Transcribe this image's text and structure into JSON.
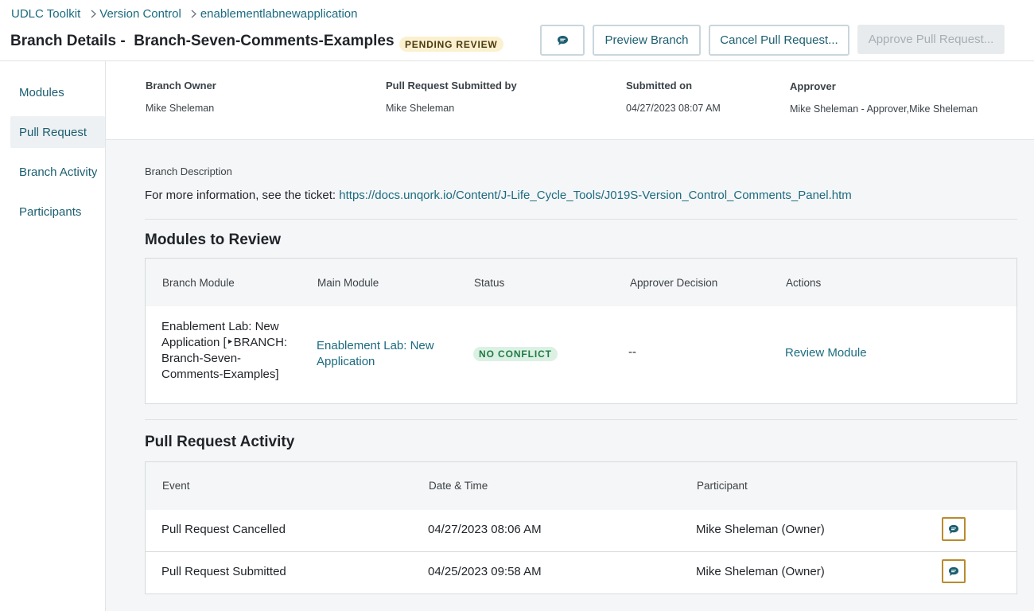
{
  "breadcrumb": {
    "items": [
      "UDLC Toolkit",
      "Version Control",
      "enablementlabnewapplication"
    ]
  },
  "header": {
    "title": "Branch Details -  Branch-Seven-Comments-Examples",
    "status_badge": "PENDING REVIEW",
    "buttons": {
      "comment_icon": "comment-icon",
      "preview": "Preview Branch",
      "cancel": "Cancel Pull Request...",
      "approve": "Approve Pull Request..."
    }
  },
  "sidebar": {
    "items": [
      {
        "label": "Modules"
      },
      {
        "label": "Pull Request"
      },
      {
        "label": "Branch Activity"
      },
      {
        "label": "Participants"
      }
    ],
    "active": "Pull Request"
  },
  "summary": {
    "owner_label": "Branch Owner",
    "owner_value": "Mike Sheleman",
    "submitted_by_label": "Pull Request Submitted by",
    "submitted_by_value": "Mike Sheleman",
    "submitted_on_label": "Submitted on",
    "submitted_on_value": "04/27/2023 08:07 AM",
    "approver_label": "Approver",
    "approver_value": "Mike Sheleman - Approver,Mike Sheleman"
  },
  "description": {
    "label": "Branch Description",
    "text": "For more information, see the ticket: ",
    "link": "https://docs.unqork.io/Content/J-Life_Cycle_Tools/J019S-Version_Control_Comments_Panel.htm"
  },
  "modules_review": {
    "title": "Modules to Review",
    "columns": [
      "Branch Module",
      "Main Module",
      "Status",
      "Approver Decision",
      "Actions"
    ],
    "rows": [
      {
        "branch_module": [
          "Enablement Lab: New",
          "Application [‣BRANCH:",
          "Branch-Seven-",
          "Comments-Examples]"
        ],
        "main_module": [
          "Enablement Lab: New",
          "Application"
        ],
        "status": "NO CONFLICT",
        "decision": "--",
        "action": "Review Module"
      }
    ]
  },
  "activity": {
    "title": "Pull Request Activity",
    "columns": [
      "Event",
      "Date & Time",
      "Participant"
    ],
    "rows": [
      {
        "event": "Pull Request Cancelled",
        "datetime": "04/27/2023 08:06 AM",
        "participant": "Mike Sheleman (Owner)"
      },
      {
        "event": "Pull Request Submitted",
        "datetime": "04/25/2023 09:58 AM",
        "participant": "Mike Sheleman (Owner)"
      }
    ]
  },
  "colors": {
    "link": "#1b6b80",
    "pending_bg": "#fbf0cf",
    "no_conflict_bg": "#dcf1e4",
    "no_conflict_text": "#1e7a45",
    "comment_border": "#b98b2e"
  }
}
